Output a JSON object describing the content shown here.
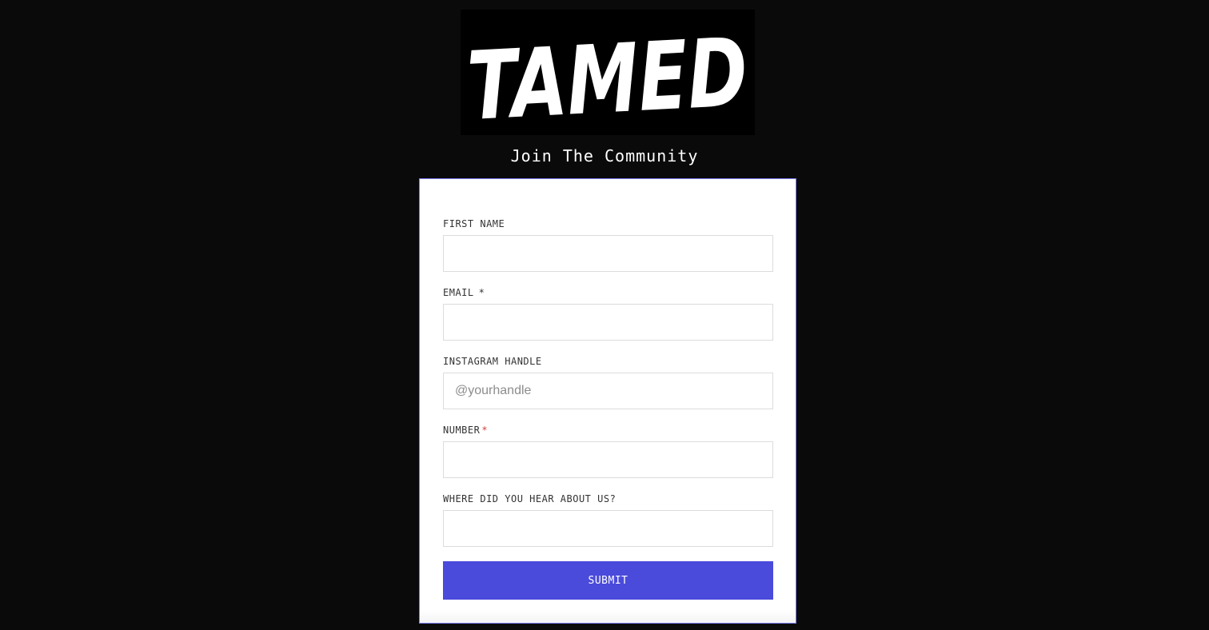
{
  "logo": {
    "text": "TAMED"
  },
  "page": {
    "title": "Join The Community"
  },
  "form": {
    "fields": [
      {
        "label": "FIRST NAME",
        "required": false,
        "value": "",
        "placeholder": ""
      },
      {
        "label": "EMAIL",
        "required": true,
        "value": "",
        "placeholder": ""
      },
      {
        "label": "INSTAGRAM HANDLE",
        "required": false,
        "value": "",
        "placeholder": "@yourhandle"
      },
      {
        "label": "NUMBER",
        "required": true,
        "value": "",
        "placeholder": ""
      },
      {
        "label": "WHERE DID YOU HEAR ABOUT US?",
        "required": false,
        "value": "",
        "placeholder": ""
      }
    ],
    "required_marker": "*",
    "submit_label": "SUBMIT"
  },
  "colors": {
    "background": "#0a0a0b",
    "card": "#ffffff",
    "accent": "#4a4adb",
    "required_red": "#d23c3c"
  }
}
